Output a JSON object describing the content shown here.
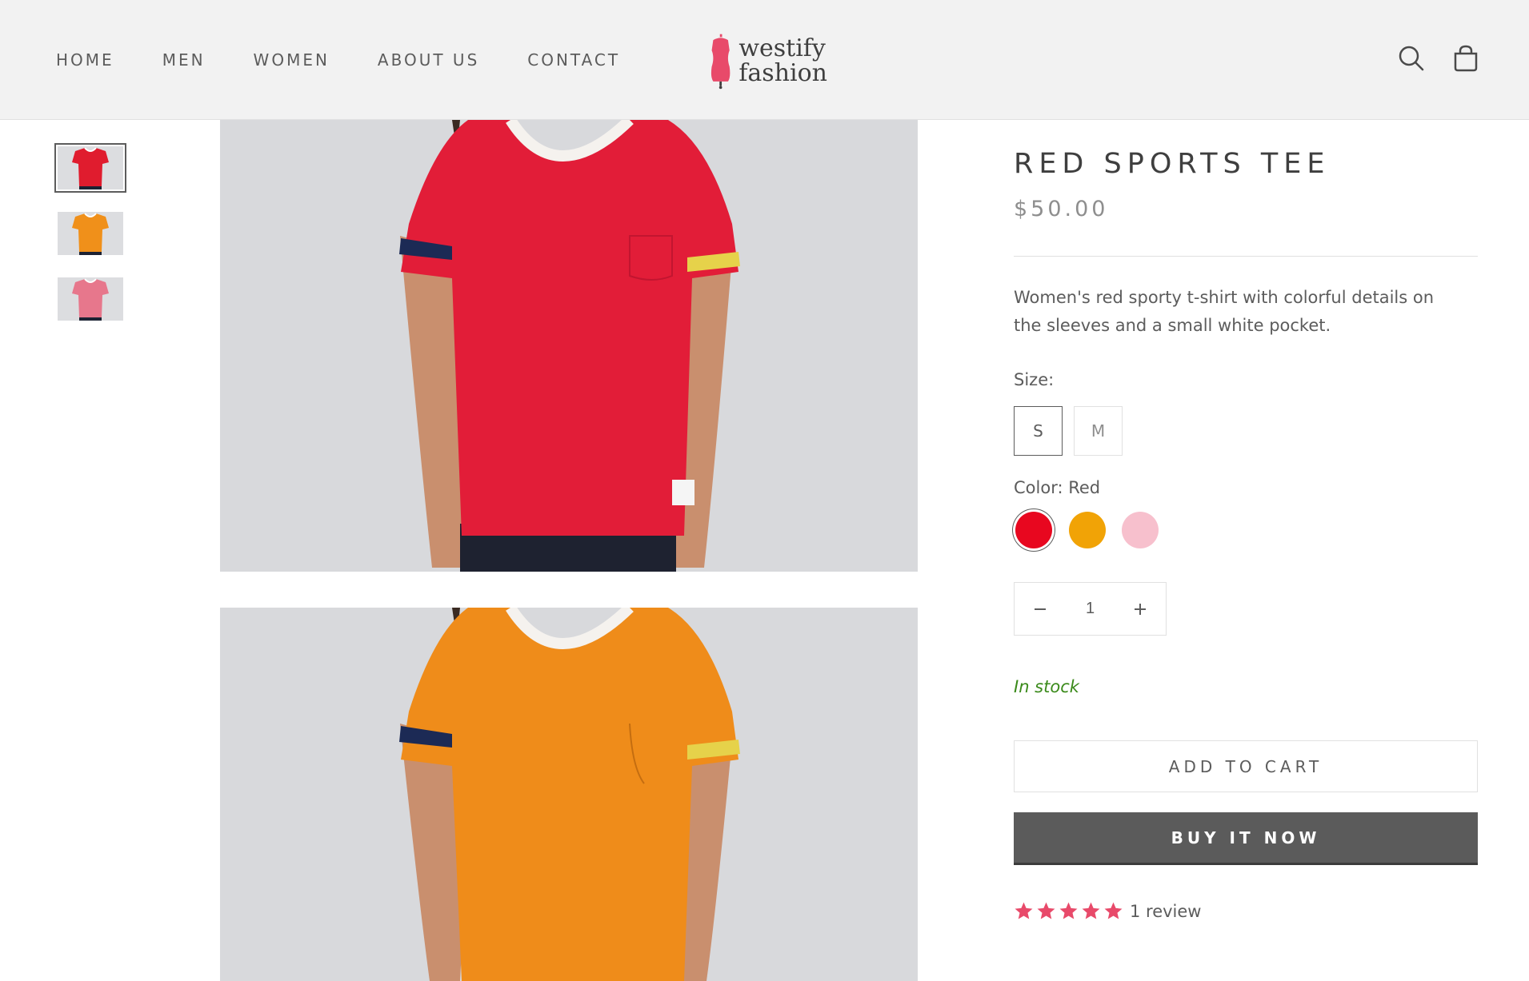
{
  "nav": {
    "items": [
      {
        "label": "HOME"
      },
      {
        "label": "MEN"
      },
      {
        "label": "WOMEN"
      },
      {
        "label": "ABOUT US"
      },
      {
        "label": "CONTACT"
      }
    ]
  },
  "logo": {
    "line1": "westify",
    "line2": "fashion",
    "icon": "dress-form-icon",
    "color": "#e84a6a"
  },
  "header_icons": [
    "search-icon",
    "shopping-bag-icon"
  ],
  "thumbnails": [
    {
      "color": "red",
      "selected": true
    },
    {
      "color": "orange",
      "selected": false
    },
    {
      "color": "pink",
      "selected": false
    }
  ],
  "product": {
    "title": "RED SPORTS TEE",
    "price": "$50.00",
    "description": "Women's red sporty t-shirt with colorful details on the sleeves and a small white pocket.",
    "size_label": "Size:",
    "sizes": [
      {
        "label": "S",
        "selected": true
      },
      {
        "label": "M",
        "selected": false
      }
    ],
    "color_label": "Color: Red",
    "colors": [
      {
        "name": "Red",
        "hex": "#e8071f",
        "selected": true
      },
      {
        "name": "Orange",
        "hex": "#f1a306",
        "selected": false
      },
      {
        "name": "Pink",
        "hex": "#f7c0cd",
        "selected": false
      }
    ],
    "quantity": "1",
    "stock_status": "In stock",
    "add_to_cart_label": "ADD TO CART",
    "buy_now_label": "BUY IT NOW",
    "rating": 5,
    "review_count_label": "1 review"
  },
  "colors": {
    "stock_green": "#3a8a1a",
    "star_pink": "#e84a6a",
    "buy_button_bg": "#5b5b5b"
  }
}
